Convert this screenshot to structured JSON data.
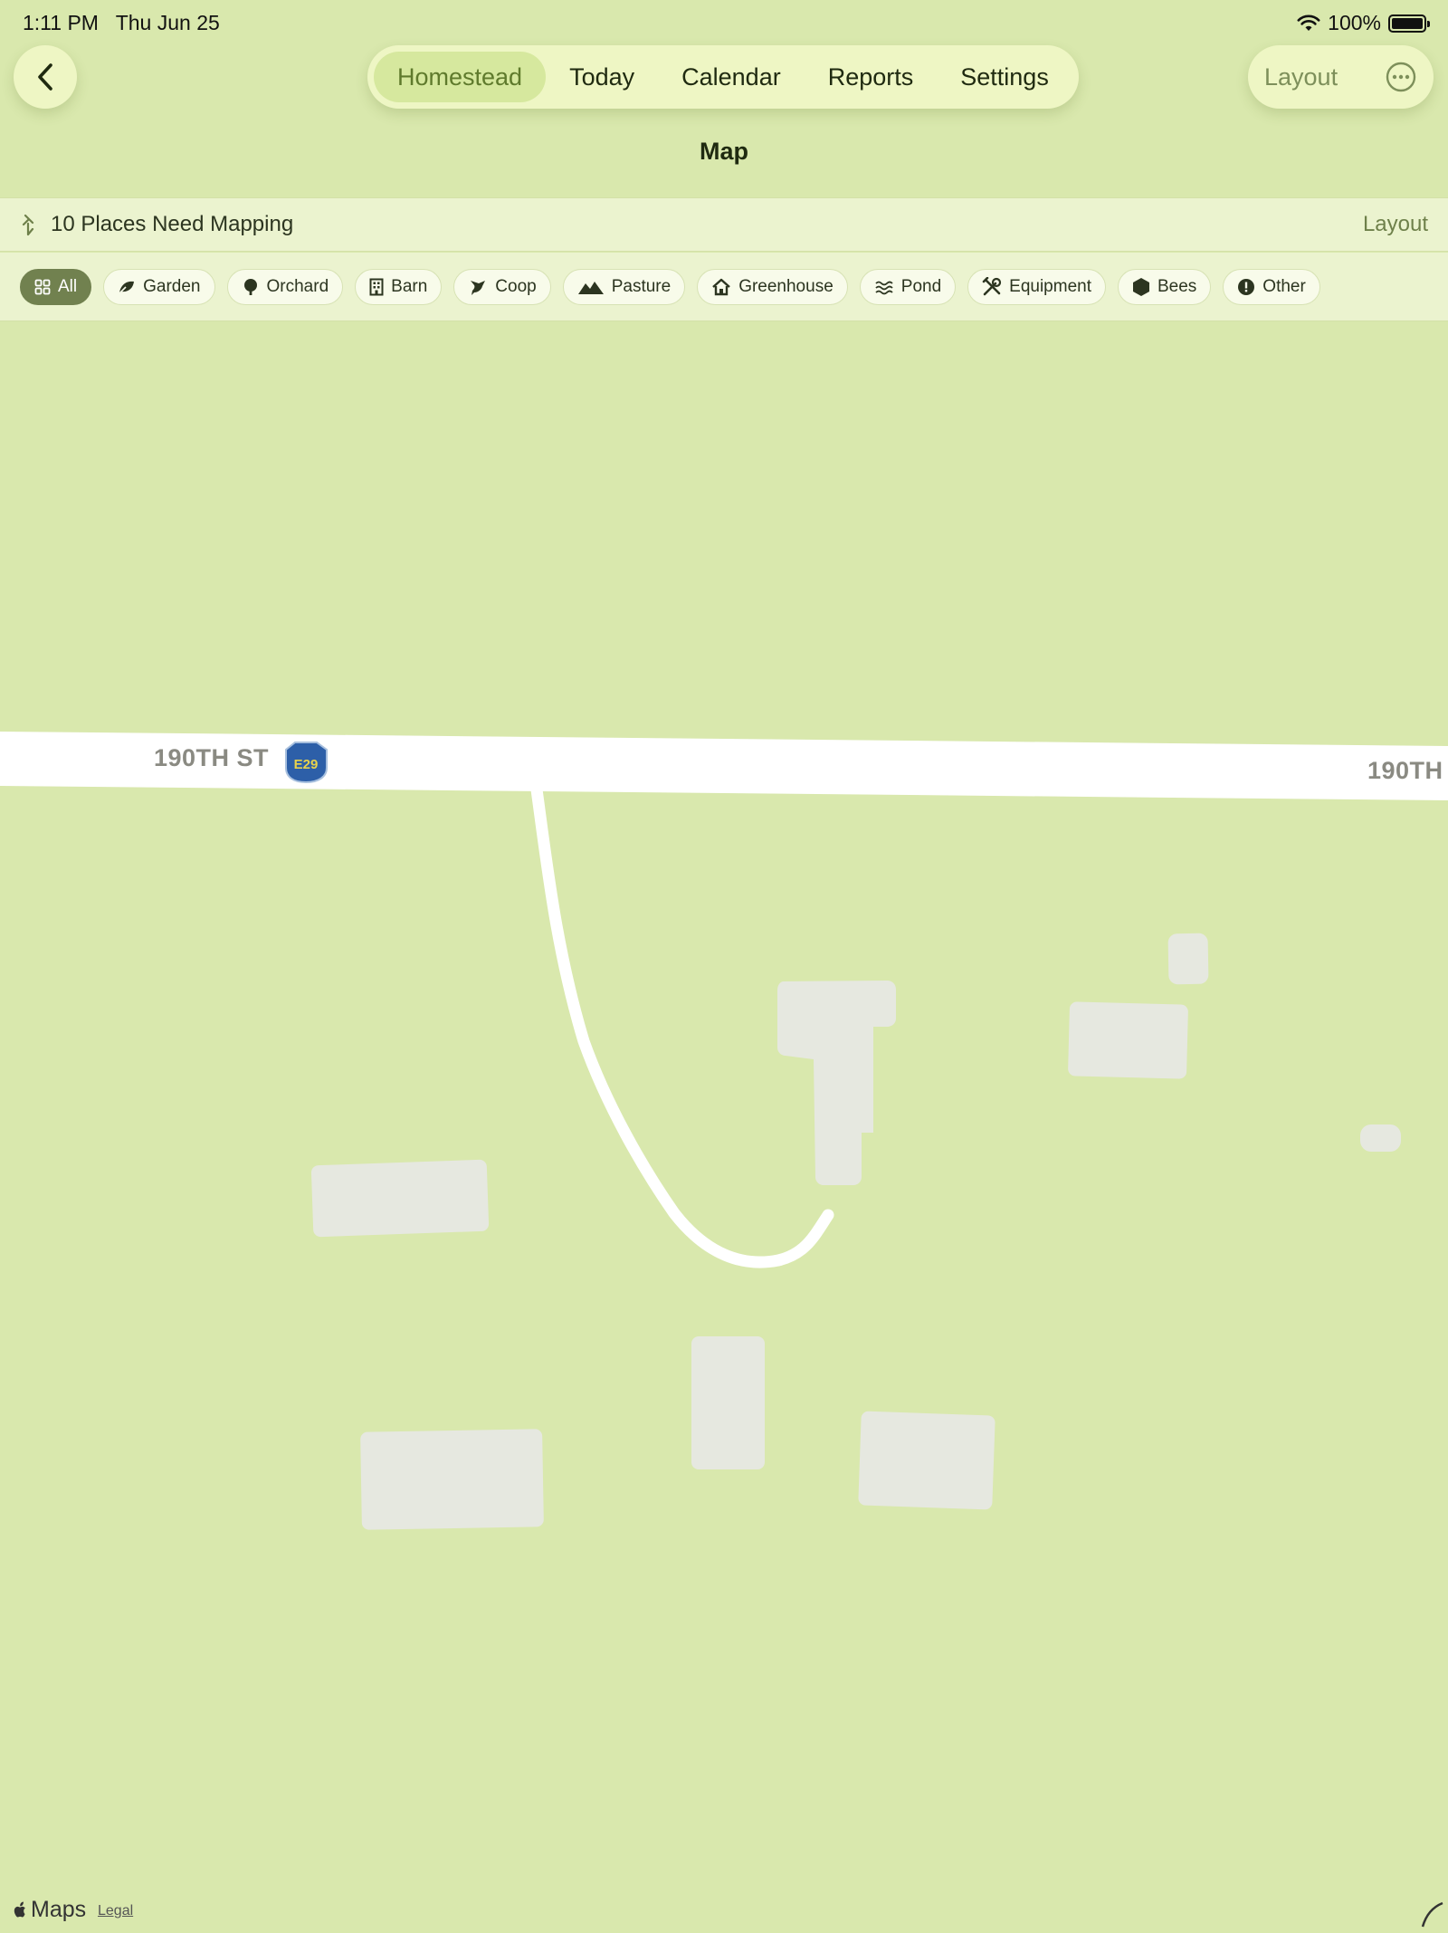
{
  "status": {
    "time": "1:11 PM",
    "date": "Thu Jun 25",
    "battery": "100%"
  },
  "nav": {
    "tabs": [
      {
        "label": "Homestead",
        "active": true
      },
      {
        "label": "Today"
      },
      {
        "label": "Calendar"
      },
      {
        "label": "Reports"
      },
      {
        "label": "Settings"
      }
    ],
    "layout_label": "Layout"
  },
  "page": {
    "title": "Map"
  },
  "banner": {
    "text": "10 Places Need Mapping",
    "action": "Layout"
  },
  "filters": [
    {
      "label": "All",
      "icon": "grid-icon",
      "active": true
    },
    {
      "label": "Garden",
      "icon": "leaf-icon"
    },
    {
      "label": "Orchard",
      "icon": "tree-icon"
    },
    {
      "label": "Barn",
      "icon": "building-icon"
    },
    {
      "label": "Coop",
      "icon": "bird-icon"
    },
    {
      "label": "Pasture",
      "icon": "mountains-icon"
    },
    {
      "label": "Greenhouse",
      "icon": "house-icon"
    },
    {
      "label": "Pond",
      "icon": "waves-icon"
    },
    {
      "label": "Equipment",
      "icon": "tools-icon"
    },
    {
      "label": "Bees",
      "icon": "hexagon-icon"
    },
    {
      "label": "Other",
      "icon": "info-icon"
    }
  ],
  "map": {
    "road_name_left": "190TH ST",
    "road_name_right": "190TH",
    "route_shield": "E29",
    "attribution": "Maps",
    "legal": "Legal"
  },
  "colors": {
    "map_bg": "#d9e8ad",
    "building": "#e6e8e0",
    "road": "#ffffff",
    "accent": "#71814f",
    "active_tab": "#5f7a2c"
  }
}
